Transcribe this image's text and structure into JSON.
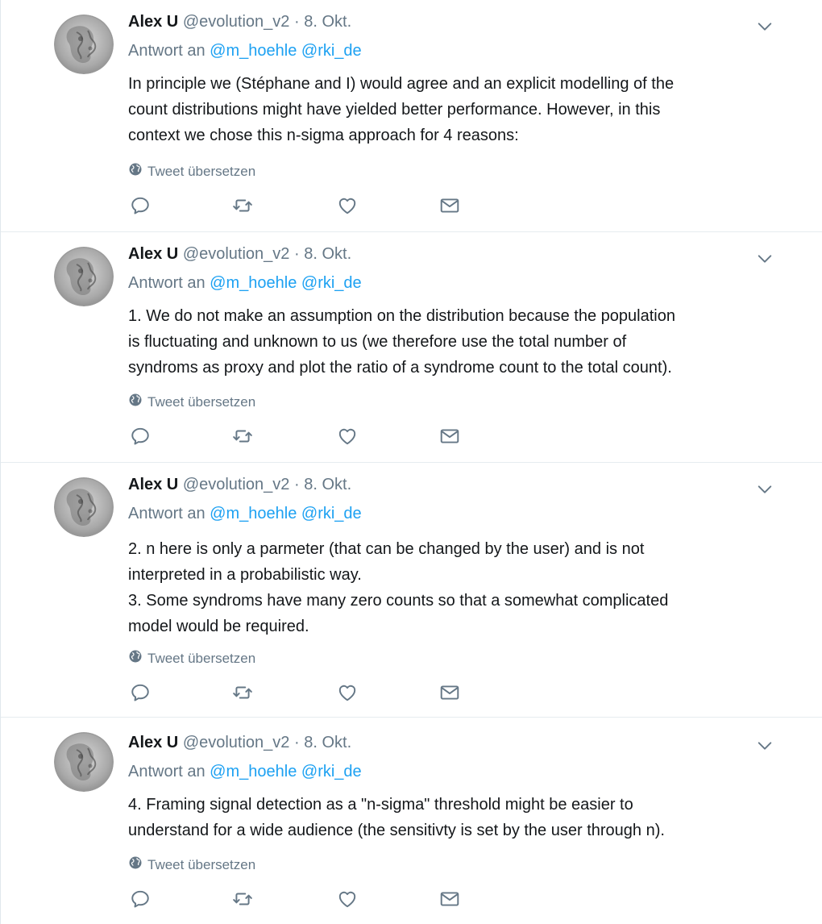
{
  "tweets": [
    {
      "name": "Alex U",
      "handle": "@evolution_v2",
      "dot": "·",
      "date": "8. Okt.",
      "reply_prefix": "Antwort an",
      "mentions": [
        "@m_hoehle",
        "@rki_de"
      ],
      "lines": [
        "In principle we (Stéphane and I) would agree and an explicit modelling of  the",
        "count distributions might have yielded better performance. However, in this",
        "context we chose this n-sigma approach for 4 reasons:"
      ],
      "translate": "Tweet übersetzen"
    },
    {
      "name": "Alex U",
      "handle": "@evolution_v2",
      "dot": "·",
      "date": "8. Okt.",
      "reply_prefix": "Antwort an",
      "mentions": [
        "@m_hoehle",
        "@rki_de"
      ],
      "lines": [
        "1. We do not make an  assumption on the distribution because the population",
        "is fluctuating and unknown  to us (we therefore use the total number of",
        "syndroms as proxy and plot the ratio  of a syndrome count to the total  count)."
      ],
      "translate": "Tweet übersetzen"
    },
    {
      "name": "Alex U",
      "handle": "@evolution_v2",
      "dot": "·",
      "date": "8. Okt.",
      "reply_prefix": "Antwort an",
      "mentions": [
        "@m_hoehle",
        "@rki_de"
      ],
      "lines": [
        "2. n here is only a parmeter (that  can be changed by the user) and is not",
        "interpreted in a probabilistic way.",
        "3.  Some syndroms have many zero counts so that a somewhat complicated",
        "model would  be required."
      ],
      "translate": "Tweet übersetzen"
    },
    {
      "name": "Alex U",
      "handle": "@evolution_v2",
      "dot": "·",
      "date": "8. Okt.",
      "reply_prefix": "Antwort an",
      "mentions": [
        "@m_hoehle",
        "@rki_de"
      ],
      "lines": [
        "4.   Framing signal detection as a \"n-sigma\" threshold might be  easier to",
        "understand for a wide audience (the sensitivty is set by the user    through n)."
      ],
      "translate": "Tweet übersetzen"
    }
  ],
  "icons": {
    "globe": "globe-icon",
    "reply": "reply-icon",
    "retweet": "retweet-icon",
    "like": "heart-icon",
    "dm": "envelope-icon",
    "caret": "chevron-down-icon"
  },
  "colors": {
    "text": "#14171a",
    "secondary": "#657786",
    "link": "#1da1f2",
    "border": "#e6ecf0"
  }
}
